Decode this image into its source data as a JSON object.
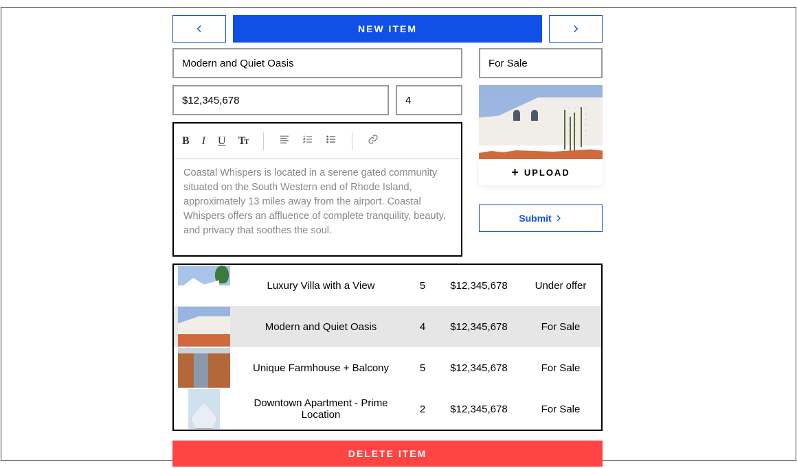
{
  "top": {
    "new_item_label": "NEW ITEM"
  },
  "form": {
    "name": "Modern and Quiet Oasis",
    "status": "For Sale",
    "price": "$12,345,678",
    "qty": "4",
    "description": "Coastal Whispers is located in a serene gated community situated on the South Western end of Rhode Island, approximately 13 miles away from the airport. Coastal Whispers offers an affluence of complete tranquility, beauty, and privacy that soothes the soul."
  },
  "upload_label": "UPLOAD",
  "submit_label": "Submit",
  "delete_label": "DELETE ITEM",
  "listings": [
    {
      "name": "Luxury Villa with a View",
      "qty": "5",
      "price": "$12,345,678",
      "status": "Under offer"
    },
    {
      "name": "Modern and Quiet Oasis",
      "qty": "4",
      "price": "$12,345,678",
      "status": "For Sale"
    },
    {
      "name": "Unique Farmhouse + Balcony",
      "qty": "5",
      "price": "$12,345,678",
      "status": "For Sale"
    },
    {
      "name": "Downtown Apartment - Prime Location",
      "qty": "2",
      "price": "$12,345,678",
      "status": "For Sale"
    }
  ]
}
